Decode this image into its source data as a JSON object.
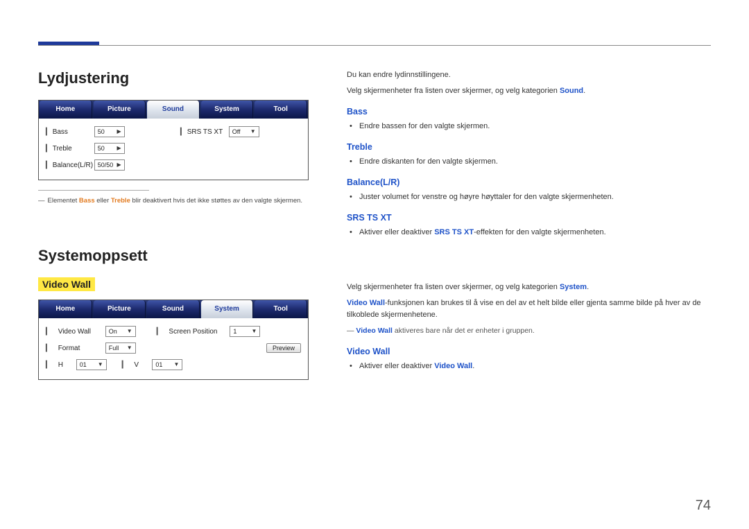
{
  "page_number": "74",
  "left": {
    "sound_title": "Lydjustering",
    "sound_ui": {
      "tabs": [
        "Home",
        "Picture",
        "Sound",
        "System",
        "Tool"
      ],
      "active_tab_index": 2,
      "rows_left": [
        {
          "label": "Bass",
          "value": "50"
        },
        {
          "label": "Treble",
          "value": "50"
        },
        {
          "label": "Balance(L/R)",
          "value": "50/50"
        }
      ],
      "rows_right": [
        {
          "label": "SRS TS XT",
          "value": "Off"
        }
      ]
    },
    "footnote_prefix": "―",
    "footnote_pre": "Elementet ",
    "footnote_bass": "Bass",
    "footnote_mid": " eller ",
    "footnote_treble": "Treble",
    "footnote_post": " blir deaktivert hvis det ikke støttes av den valgte skjermen.",
    "system_title": "Systemoppsett",
    "videowall_label": "Video Wall",
    "system_ui": {
      "tabs": [
        "Home",
        "Picture",
        "Sound",
        "System",
        "Tool"
      ],
      "active_tab_index": 3,
      "top_row": {
        "videowall_label": "Video Wall",
        "videowall_value": "On",
        "screenpos_label": "Screen Position",
        "screenpos_value": "1"
      },
      "mid_row": {
        "format_label": "Format",
        "format_value": "Full",
        "preview_label": "Preview"
      },
      "bot_row": {
        "h_label": "H",
        "h_value": "01",
        "v_label": "V",
        "v_value": "01"
      }
    }
  },
  "right": {
    "intro1": "Du kan endre lydinnstillingene.",
    "intro2_pre": "Velg skjermenheter fra listen over skjermer, og velg kategorien ",
    "intro2_sound": "Sound",
    "intro2_post": ".",
    "bass_h": "Bass",
    "bass_b": "Endre bassen for den valgte skjermen.",
    "treble_h": "Treble",
    "treble_b": "Endre diskanten for den valgte skjermen.",
    "balance_h": "Balance(L/R)",
    "balance_b": "Juster volumet for venstre og høyre høyttaler for den valgte skjermenheten.",
    "srs_h": "SRS TS XT",
    "srs_b_pre": "Aktiver eller deaktiver ",
    "srs_b_bold": "SRS TS XT",
    "srs_b_post": "-effekten for den valgte skjermenheten.",
    "sys_intro_pre": "Velg skjermenheter fra listen over skjermer, og velg kategorien ",
    "sys_intro_system": "System",
    "sys_intro_post": ".",
    "vw_para_bold": "Video Wall",
    "vw_para_post": "-funksjonen kan brukes til å vise en del av et helt bilde eller gjenta samme bilde på hver av de tilkoblede skjermenhetene.",
    "vw_note_dash": "―",
    "vw_note_bold": "Video Wall",
    "vw_note_post": " aktiveres bare når det er enheter i gruppen.",
    "vw_sub_h": "Video Wall",
    "vw_sub_b_pre": "Aktiver eller deaktiver ",
    "vw_sub_b_bold": "Video Wall",
    "vw_sub_b_post": "."
  }
}
